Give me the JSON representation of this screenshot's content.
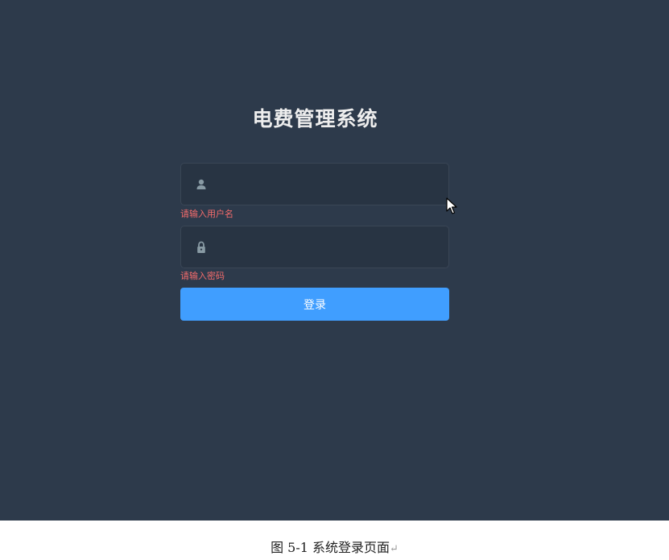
{
  "login": {
    "title": "电费管理系统",
    "username": {
      "value": "",
      "placeholder": "",
      "icon": "user-icon",
      "error": "请输入用户名"
    },
    "password": {
      "value": "",
      "placeholder": "",
      "icon": "lock-icon",
      "error": "请输入密码"
    },
    "submit_label": "登录"
  },
  "caption": {
    "text": "图 5-1 系统登录页面",
    "mark": "↵"
  },
  "colors": {
    "background": "#2d3a4b",
    "input_background": "#283443",
    "error": "#f56c6c",
    "primary": "#409eff",
    "title": "#eeeeee"
  }
}
